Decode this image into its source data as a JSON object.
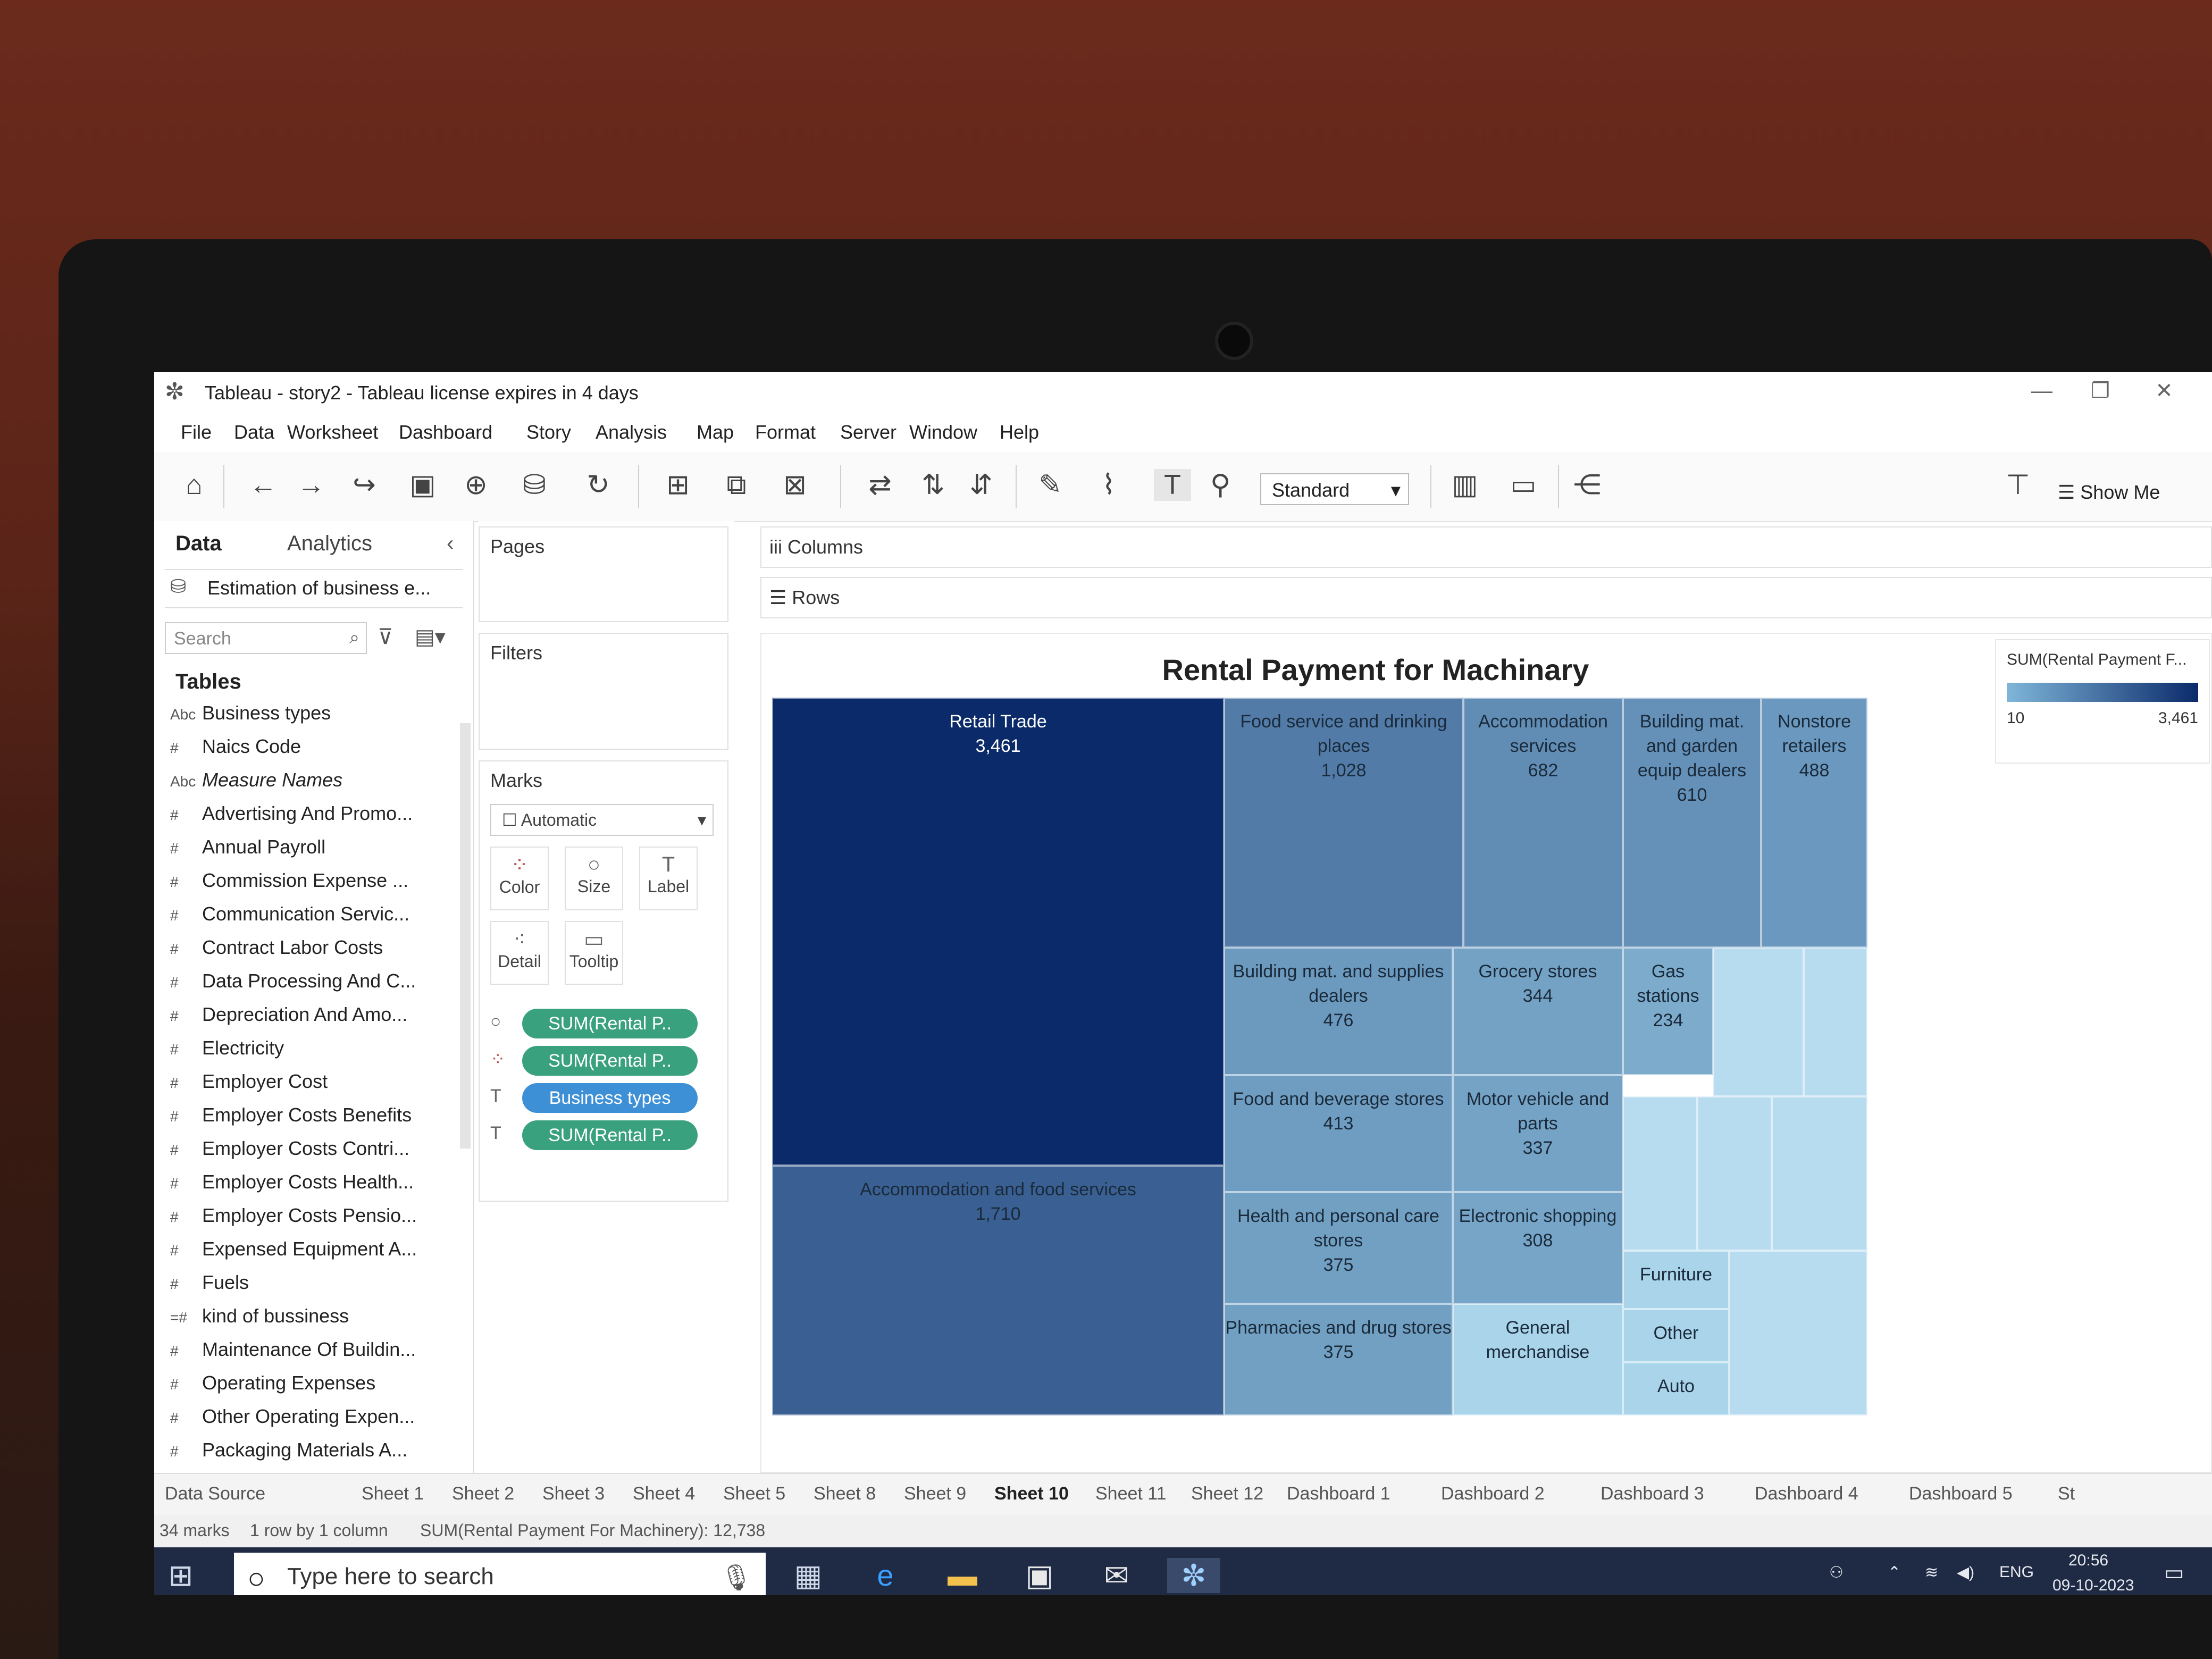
{
  "window": {
    "title": "Tableau - story2 - Tableau license expires in 4 days"
  },
  "menu": [
    "File",
    "Data",
    "Worksheet",
    "Dashboard",
    "Story",
    "Analysis",
    "Map",
    "Format",
    "Server",
    "Window",
    "Help"
  ],
  "toolbar": {
    "fit_select": "Standard",
    "show_me": "Show Me"
  },
  "datapane": {
    "tab_data": "Data",
    "tab_analytics": "Analytics",
    "datasource": "Estimation of business e...",
    "search_placeholder": "Search",
    "tables_heading": "Tables",
    "fields": [
      {
        "type": "Abc",
        "name": "Business types"
      },
      {
        "type": "#",
        "name": "Naics Code"
      },
      {
        "type": "Abc",
        "name": "Measure Names"
      },
      {
        "type": "#",
        "name": "Advertising And Promo..."
      },
      {
        "type": "#",
        "name": "Annual Payroll"
      },
      {
        "type": "#",
        "name": "Commission Expense ..."
      },
      {
        "type": "#",
        "name": "Communication Servic..."
      },
      {
        "type": "#",
        "name": "Contract Labor Costs"
      },
      {
        "type": "#",
        "name": "Data Processing And C..."
      },
      {
        "type": "#",
        "name": "Depreciation And Amo..."
      },
      {
        "type": "#",
        "name": "Electricity"
      },
      {
        "type": "#",
        "name": "Employer Cost"
      },
      {
        "type": "#",
        "name": "Employer Costs Benefits"
      },
      {
        "type": "#",
        "name": "Employer Costs Contri..."
      },
      {
        "type": "#",
        "name": "Employer Costs Health..."
      },
      {
        "type": "#",
        "name": "Employer Costs Pensio..."
      },
      {
        "type": "#",
        "name": "Expensed Equipment A..."
      },
      {
        "type": "#",
        "name": "Fuels"
      },
      {
        "type": "=#",
        "name": "kind of bussiness"
      },
      {
        "type": "#",
        "name": "Maintenance Of Buildin..."
      },
      {
        "type": "#",
        "name": "Operating Expenses"
      },
      {
        "type": "#",
        "name": "Other Operating Expen..."
      },
      {
        "type": "#",
        "name": "Packaging Materials A..."
      }
    ]
  },
  "shelves": {
    "pages": "Pages",
    "filters": "Filters",
    "marks": "Marks",
    "mark_type": "Automatic",
    "mark_buttons": [
      "Color",
      "Size",
      "Label",
      "Detail",
      "Tooltip"
    ],
    "pills": [
      {
        "label": "SUM(Rental P..",
        "color": "#3aa17e"
      },
      {
        "label": "SUM(Rental P..",
        "color": "#3aa17e"
      },
      {
        "label": "Business types",
        "color": "#3d8fd6"
      },
      {
        "label": "SUM(Rental P..",
        "color": "#3aa17e"
      }
    ],
    "columns": "Columns",
    "rows": "Rows"
  },
  "chart_data": {
    "type": "treemap",
    "title": "Rental Payment for Machinary",
    "measure": "SUM(Rental Payment F...",
    "color_range": [
      10,
      3461
    ],
    "color_min_label": "10",
    "color_max_label": "3,461",
    "items": [
      {
        "label": "Retail Trade",
        "value": 3461,
        "value_label": "3,461"
      },
      {
        "label": "Accommodation and food services",
        "value": 1710,
        "value_label": "1,710"
      },
      {
        "label": "Food service and drinking places",
        "value": 1028,
        "value_label": "1,028"
      },
      {
        "label": "Accommodation services",
        "value": 682,
        "value_label": "682"
      },
      {
        "label": "Building mat. and garden equip dealers",
        "value": 610,
        "value_label": "610"
      },
      {
        "label": "Nonstore retailers",
        "value": 488,
        "value_label": "488"
      },
      {
        "label": "Building mat. and supplies dealers",
        "value": 476,
        "value_label": "476"
      },
      {
        "label": "Grocery stores",
        "value": 344,
        "value_label": "344"
      },
      {
        "label": "Gas stations",
        "value": 234,
        "value_label": "234"
      },
      {
        "label": "Food and beverage stores",
        "value": 413,
        "value_label": "413"
      },
      {
        "label": "Motor vehicle and parts",
        "value": 337,
        "value_label": "337"
      },
      {
        "label": "Health and personal care stores",
        "value": 375,
        "value_label": "375"
      },
      {
        "label": "Electronic shopping",
        "value": 308,
        "value_label": "308"
      },
      {
        "label": "Pharmacies and drug stores",
        "value": 375,
        "value_label": "375"
      },
      {
        "label": "General merchandise",
        "value": null,
        "value_label": ""
      },
      {
        "label": "Furniture",
        "value": null,
        "value_label": ""
      },
      {
        "label": "Other",
        "value": null,
        "value_label": ""
      },
      {
        "label": "Auto",
        "value": null,
        "value_label": ""
      }
    ]
  },
  "sheet_tabs": [
    "Data Source",
    "Sheet 1",
    "Sheet 2",
    "Sheet 3",
    "Sheet 4",
    "Sheet 5",
    "Sheet 8",
    "Sheet 9",
    "Sheet 10",
    "Sheet 11",
    "Sheet 12",
    "Dashboard 1",
    "Dashboard 2",
    "Dashboard 3",
    "Dashboard 4",
    "Dashboard 5",
    "St"
  ],
  "active_tab": "Sheet 10",
  "status": {
    "marks": "34 marks",
    "dims": "1 row by 1 column",
    "sum": "SUM(Rental Payment For Machinery): 12,738"
  },
  "taskbar": {
    "search_placeholder": "Type here to search",
    "lang": "ENG",
    "time": "20:56",
    "date": "09-10-2023"
  }
}
